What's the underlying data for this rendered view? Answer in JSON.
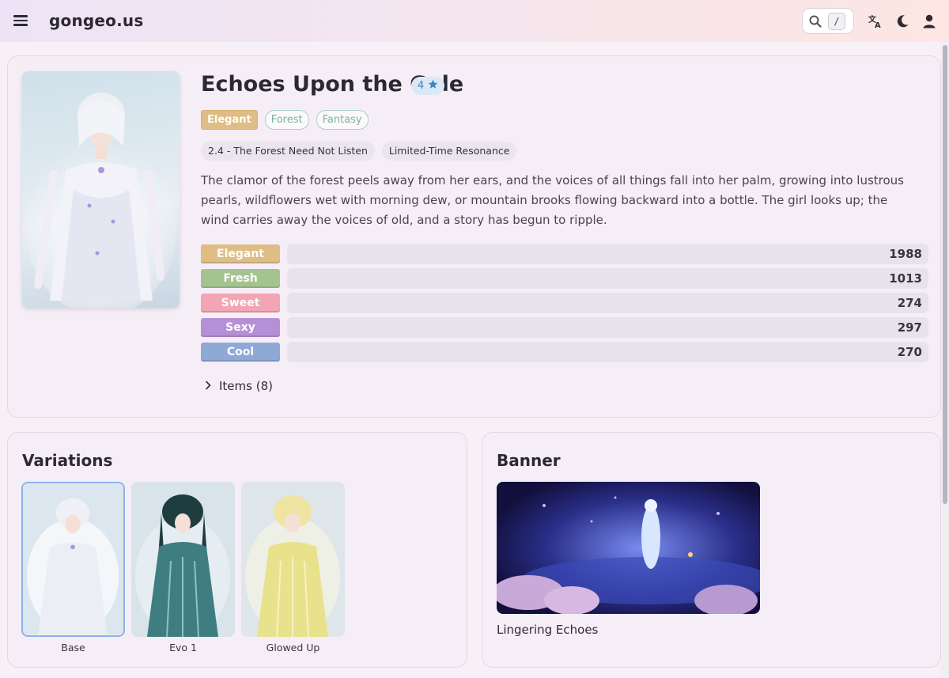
{
  "header": {
    "brand": "gongeo.us",
    "search_shortcut": "/",
    "icons": [
      "menu-icon",
      "search-icon",
      "translate-icon",
      "moon-icon",
      "user-icon"
    ]
  },
  "outfit": {
    "title": "Echoes Upon the Gale",
    "rarity": "4",
    "tags": [
      "Elegant",
      "Forest",
      "Fantasy"
    ],
    "chips": [
      "2.4 - The Forest Need Not Listen",
      "Limited-Time Resonance"
    ],
    "description": "The clamor of the forest peels away from her ears, and the voices of all things fall into her palm, growing into lustrous pearls, wildflowers wet with morning dew, or mountain brooks flowing backward into a bottle. The girl looks up; the wind carries away the voices of old, and a story has begun to ripple.",
    "stats": [
      {
        "label": "Elegant",
        "value": "1988",
        "color": "#dfbd84"
      },
      {
        "label": "Fresh",
        "value": "1013",
        "color": "#a3c48f"
      },
      {
        "label": "Sweet",
        "value": "274",
        "color": "#f2a5b3"
      },
      {
        "label": "Sexy",
        "value": "297",
        "color": "#b690d6"
      },
      {
        "label": "Cool",
        "value": "270",
        "color": "#8fa9d6"
      }
    ],
    "items_label": "Items (8)"
  },
  "variations": {
    "title": "Variations",
    "items": [
      {
        "label": "Base",
        "selected": true
      },
      {
        "label": "Evo 1",
        "selected": false
      },
      {
        "label": "Glowed Up",
        "selected": false
      }
    ]
  },
  "banner": {
    "title": "Banner",
    "caption": "Lingering Echoes"
  }
}
